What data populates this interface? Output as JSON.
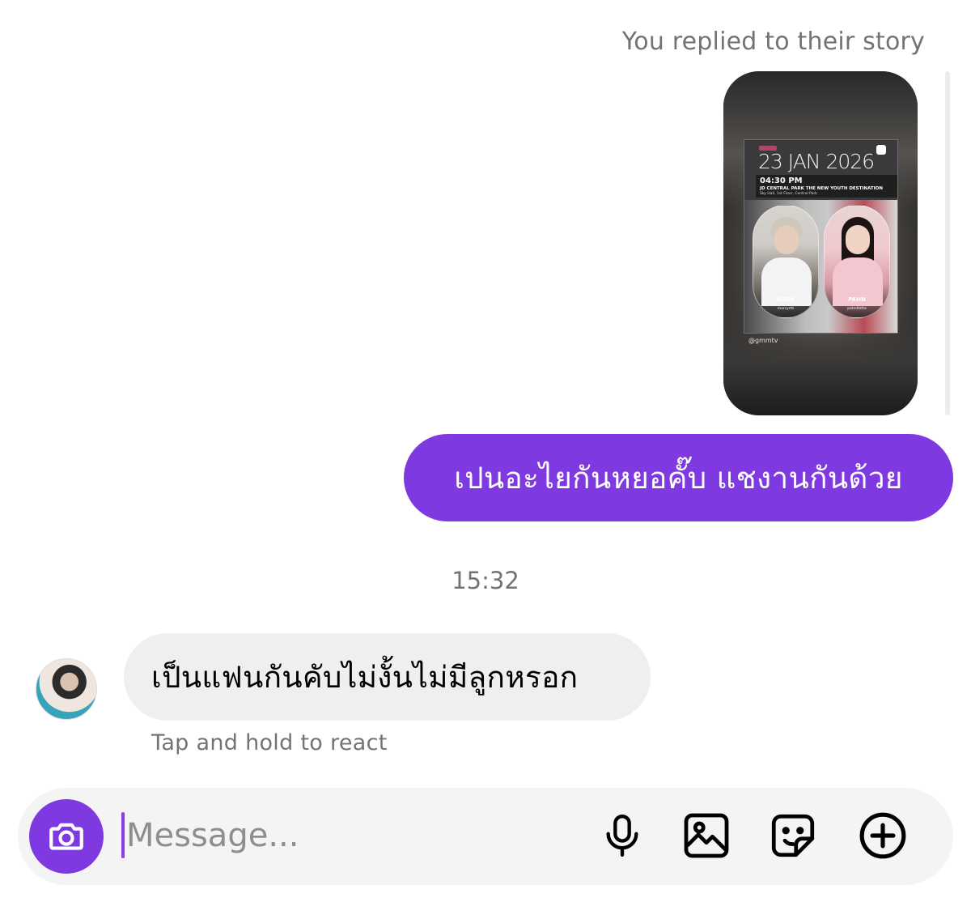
{
  "thread": {
    "reply_note": "You replied to their story",
    "story": {
      "date": "23 JAN 2026",
      "time": "04:30 PM",
      "venue": "JD CENTRAL PARK THE NEW YOUTH DESTINATION",
      "location": "Sky Hall, 1st Floor, Central Park",
      "person_left": {
        "name": "MARK",
        "handle": "marcyrth"
      },
      "person_right": {
        "name": "PAHN",
        "handle": "pahnthitta"
      },
      "handle": "@gmmtv"
    },
    "sent_message": "เปนอะไยกันหยอคั๊บ แชงานกันด้วย",
    "timestamp": "15:32",
    "received_message": "เป็นแฟนกันคับไม่งั้นไม่มีลูกหรอก",
    "react_hint": "Tap and hold to react"
  },
  "composer": {
    "placeholder": "Message...",
    "icons": [
      "camera-icon",
      "microphone-icon",
      "gallery-icon",
      "sticker-icon",
      "plus-circle-icon"
    ]
  },
  "colors": {
    "accent": "#7e3ae0",
    "received_bubble": "#efefef",
    "muted_text": "#737373"
  }
}
